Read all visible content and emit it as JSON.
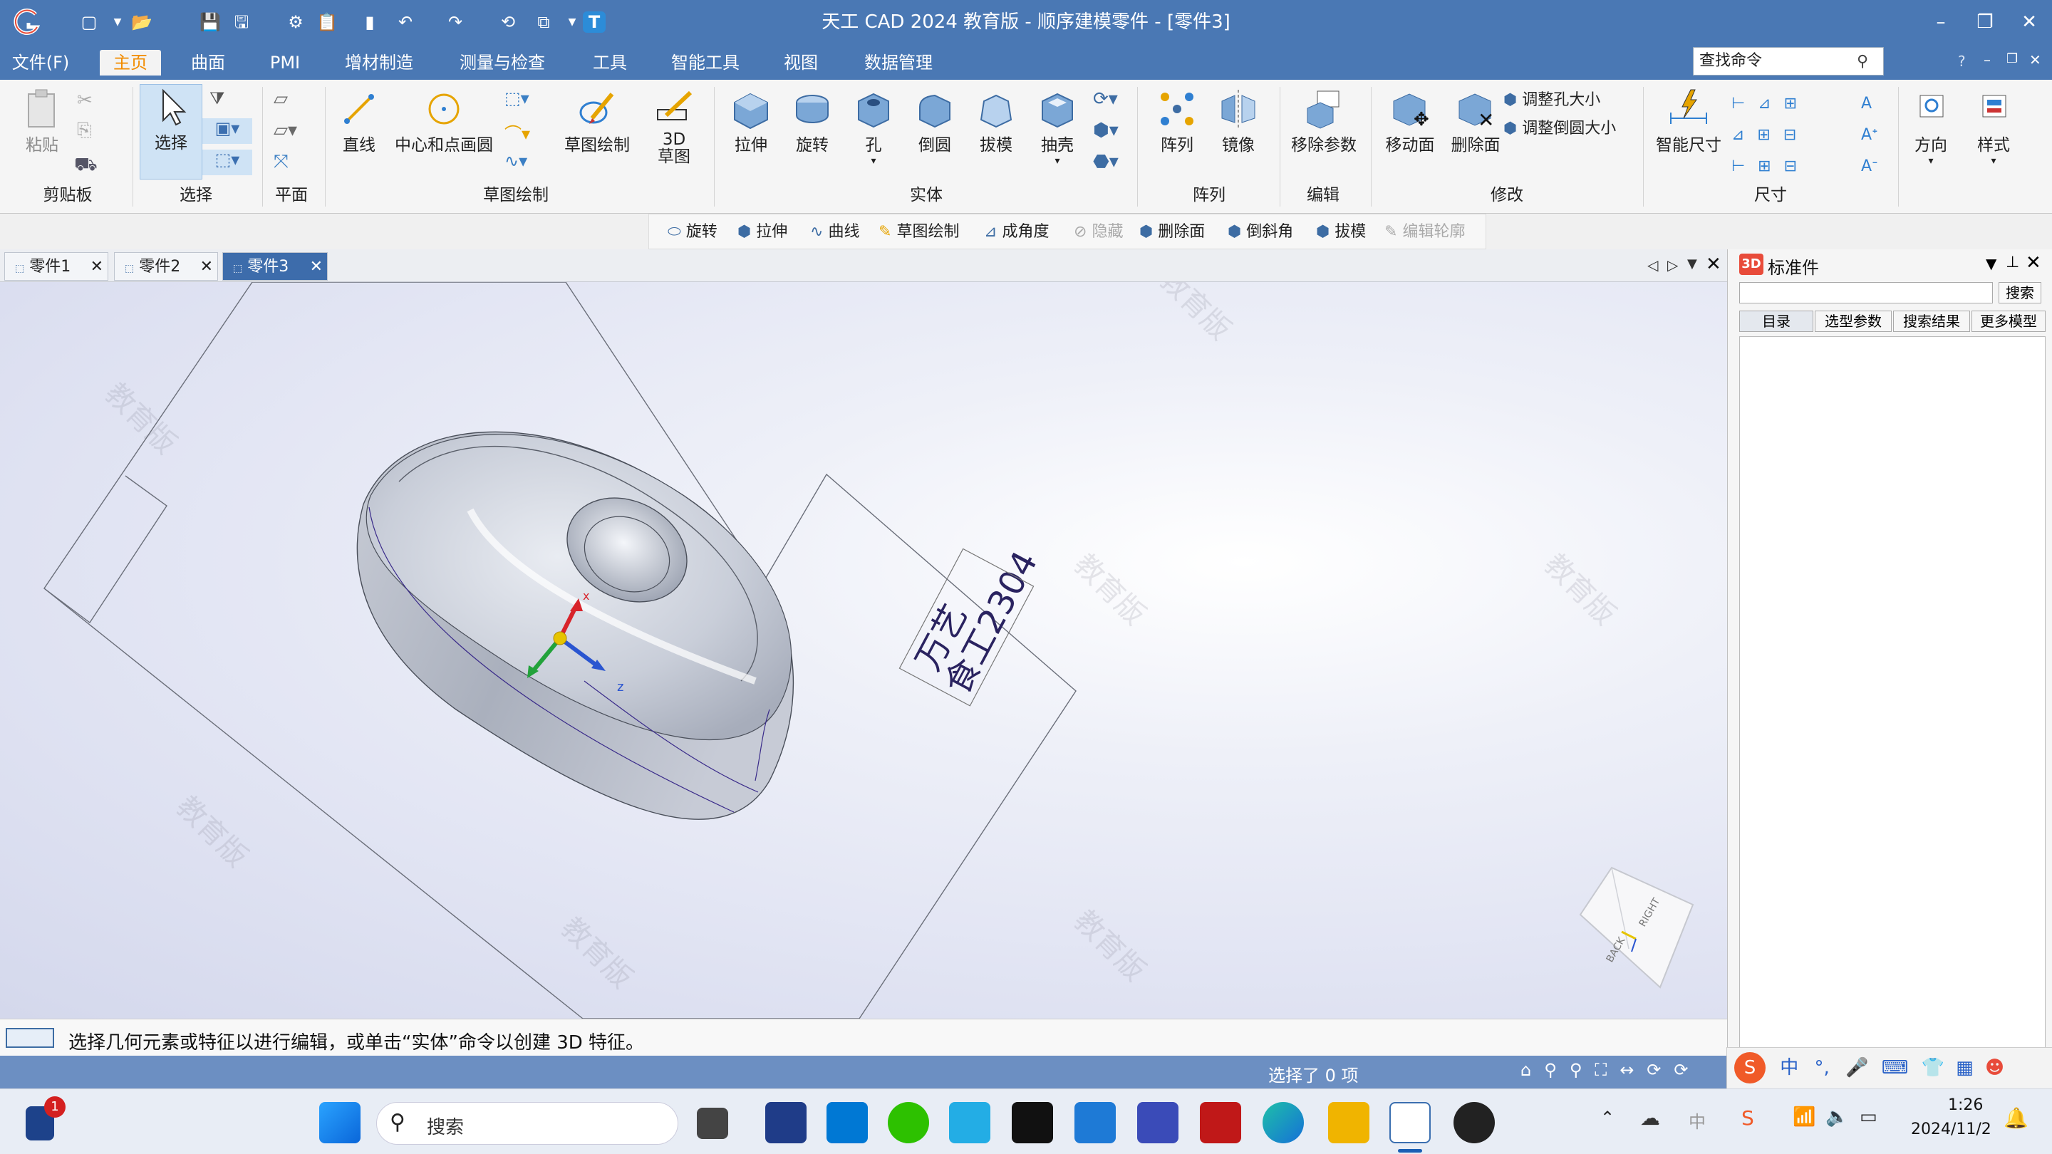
{
  "window": {
    "title": "天工 CAD 2024 教育版 - 顺序建模零件 - [零件3]"
  },
  "menu": {
    "file": "文件(F)",
    "items": [
      "主页",
      "曲面",
      "PMI",
      "增材制造",
      "测量与检查",
      "工具",
      "智能工具",
      "视图",
      "数据管理"
    ],
    "search_placeholder": "查找命令"
  },
  "ribbon": {
    "clipboard": {
      "paste": "粘贴",
      "group": "剪贴板"
    },
    "select": {
      "select": "选择",
      "group": "选择"
    },
    "plane": {
      "group": "平面"
    },
    "sketch": {
      "line": "直线",
      "circle": "中心和点画圆",
      "sketch_draw": "草图绘制",
      "sketch3d": "3D\n草图",
      "group": "草图绘制"
    },
    "solid": {
      "extrude": "拉伸",
      "revolve": "旋转",
      "hole": "孔",
      "round": "倒圆",
      "draft": "拔模",
      "shell": "抽壳",
      "group": "实体"
    },
    "pattern": {
      "pattern": "阵列",
      "mirror": "镜像",
      "group": "阵列"
    },
    "edit": {
      "remove_params": "移除参数",
      "group": "编辑"
    },
    "modify": {
      "move_face": "移动面",
      "delete_face": "删除面",
      "resize_hole": "调整孔大小",
      "resize_round": "调整倒圆大小",
      "group": "修改"
    },
    "dimension": {
      "smart": "智能尺寸",
      "group": "尺寸"
    },
    "orient": {
      "direction": "方向",
      "style": "样式"
    }
  },
  "feature_bar": [
    "旋转",
    "拉伸",
    "曲线",
    "草图绘制",
    "成角度",
    "隐藏",
    "删除面",
    "倒斜角",
    "拔模",
    "编辑轮廓"
  ],
  "doc_tabs": [
    "零件1",
    "零件2",
    "零件3"
  ],
  "active_tab": 2,
  "viewport": {
    "watermark": "教育版",
    "annotation_line1": "万艺",
    "annotation_line2": "食工2304",
    "cube_right": "RIGHT",
    "cube_back": "BACK",
    "axis_x": "x",
    "axis_z": "z"
  },
  "status": {
    "prompt": "选择几何元素或特征以进行编辑，或单击“实体”命令以创建 3D 特征。",
    "selected": "选择了 0 项"
  },
  "panel": {
    "title": "标准件",
    "badge": "3D",
    "search_button": "搜索",
    "tabs": [
      "目录",
      "选型参数",
      "搜索结果",
      "更多模型"
    ]
  },
  "taskbar": {
    "search": "搜索",
    "time": "1:26",
    "date": "2024/11/2",
    "badge": "1",
    "ime": "中",
    "ime_lang": "中"
  },
  "colors": {
    "title": "#4a78b4",
    "accent": "#f28c00",
    "tab_active": "#3d6cab"
  }
}
